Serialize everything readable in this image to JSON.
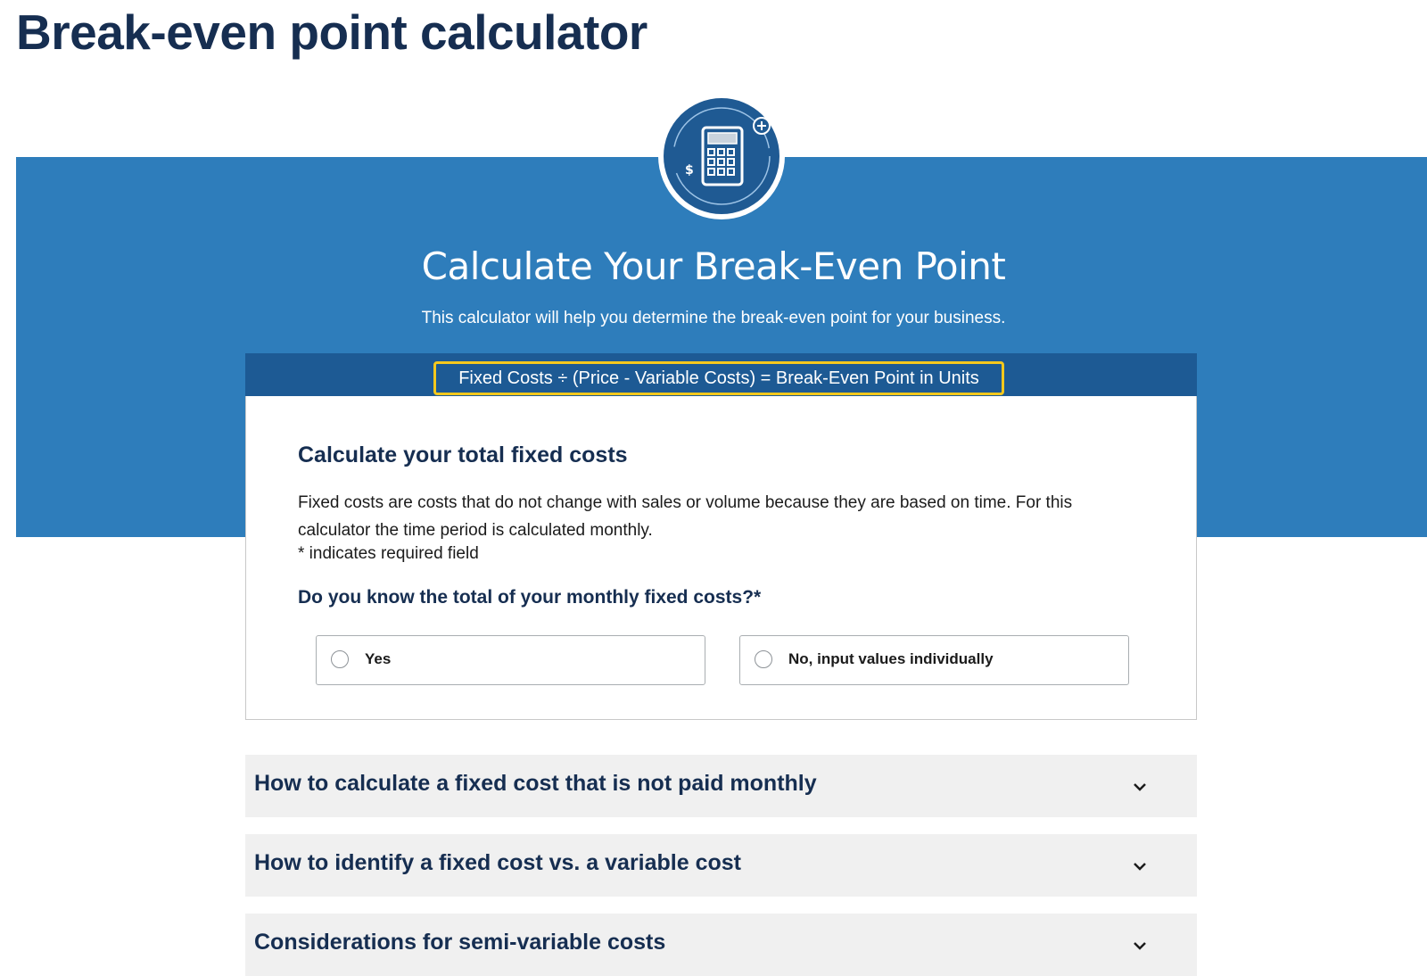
{
  "page": {
    "title": "Break-even point calculator"
  },
  "hero": {
    "icon": "calculator-icon",
    "heading": "Calculate Your Break-Even Point",
    "subheading": "This calculator will help you determine the break-even point for your business.",
    "formula": "Fixed Costs ÷ (Price - Variable Costs) = Break-Even Point in Units"
  },
  "card": {
    "heading": "Calculate your total fixed costs",
    "description": "Fixed costs are costs that do not change with sales or volume because they are based on time. For this calculator the time period is calculated monthly.",
    "required_note": "* indicates required field",
    "question": "Do you know the total of your monthly fixed costs?*",
    "options": [
      {
        "label": "Yes",
        "selected": false
      },
      {
        "label": "No, input values individually",
        "selected": false
      }
    ]
  },
  "accordions": [
    {
      "title": "How to calculate a fixed cost that is not paid monthly",
      "icon": "chevron-down-icon"
    },
    {
      "title": "How to identify a fixed cost vs. a variable cost",
      "icon": "chevron-down-icon"
    },
    {
      "title": "Considerations for semi-variable costs",
      "icon": "chevron-down-icon"
    }
  ],
  "colors": {
    "navy": "#162e51",
    "hero_blue": "#2e7dbb",
    "formula_bar": "#1d5a94",
    "highlight": "#f5c81d",
    "accordion_bg": "#f0f0f0"
  }
}
